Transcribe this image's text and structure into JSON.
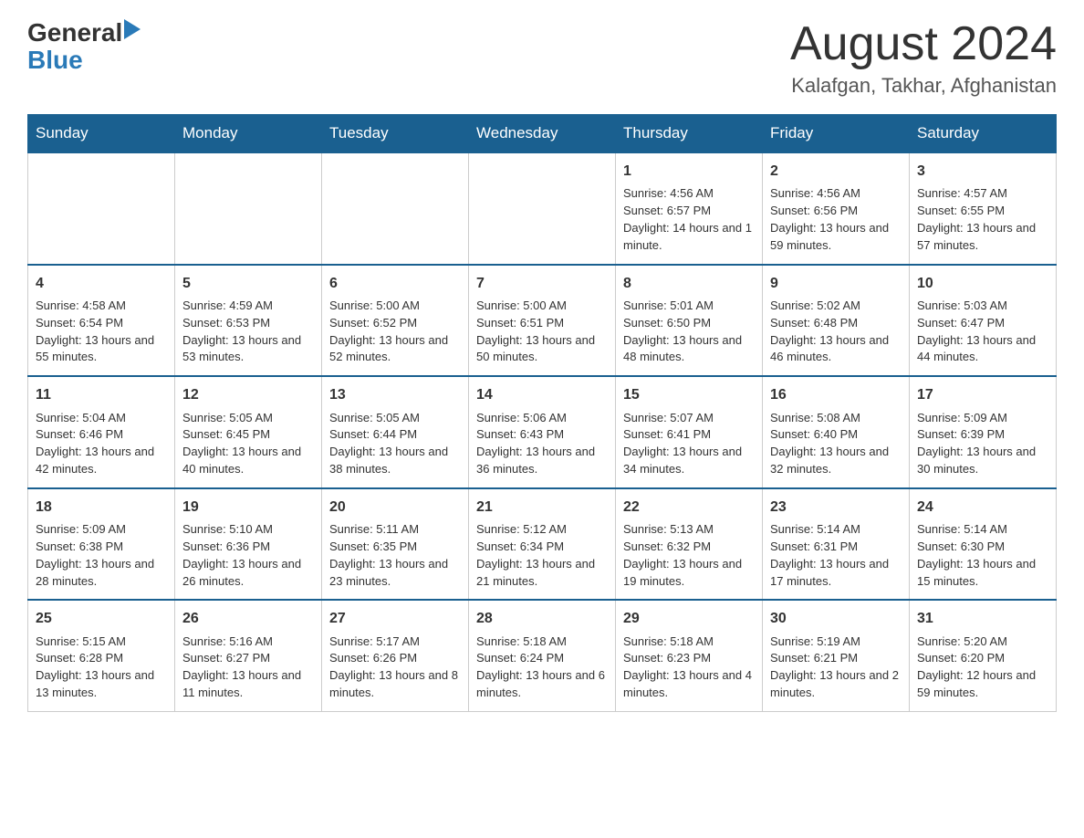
{
  "header": {
    "logo_general": "General",
    "logo_blue": "Blue",
    "month_title": "August 2024",
    "location": "Kalafgan, Takhar, Afghanistan"
  },
  "weekdays": [
    "Sunday",
    "Monday",
    "Tuesday",
    "Wednesday",
    "Thursday",
    "Friday",
    "Saturday"
  ],
  "weeks": [
    [
      {
        "day": "",
        "sunrise": "",
        "sunset": "",
        "daylight": ""
      },
      {
        "day": "",
        "sunrise": "",
        "sunset": "",
        "daylight": ""
      },
      {
        "day": "",
        "sunrise": "",
        "sunset": "",
        "daylight": ""
      },
      {
        "day": "",
        "sunrise": "",
        "sunset": "",
        "daylight": ""
      },
      {
        "day": "1",
        "sunrise": "Sunrise: 4:56 AM",
        "sunset": "Sunset: 6:57 PM",
        "daylight": "Daylight: 14 hours and 1 minute."
      },
      {
        "day": "2",
        "sunrise": "Sunrise: 4:56 AM",
        "sunset": "Sunset: 6:56 PM",
        "daylight": "Daylight: 13 hours and 59 minutes."
      },
      {
        "day": "3",
        "sunrise": "Sunrise: 4:57 AM",
        "sunset": "Sunset: 6:55 PM",
        "daylight": "Daylight: 13 hours and 57 minutes."
      }
    ],
    [
      {
        "day": "4",
        "sunrise": "Sunrise: 4:58 AM",
        "sunset": "Sunset: 6:54 PM",
        "daylight": "Daylight: 13 hours and 55 minutes."
      },
      {
        "day": "5",
        "sunrise": "Sunrise: 4:59 AM",
        "sunset": "Sunset: 6:53 PM",
        "daylight": "Daylight: 13 hours and 53 minutes."
      },
      {
        "day": "6",
        "sunrise": "Sunrise: 5:00 AM",
        "sunset": "Sunset: 6:52 PM",
        "daylight": "Daylight: 13 hours and 52 minutes."
      },
      {
        "day": "7",
        "sunrise": "Sunrise: 5:00 AM",
        "sunset": "Sunset: 6:51 PM",
        "daylight": "Daylight: 13 hours and 50 minutes."
      },
      {
        "day": "8",
        "sunrise": "Sunrise: 5:01 AM",
        "sunset": "Sunset: 6:50 PM",
        "daylight": "Daylight: 13 hours and 48 minutes."
      },
      {
        "day": "9",
        "sunrise": "Sunrise: 5:02 AM",
        "sunset": "Sunset: 6:48 PM",
        "daylight": "Daylight: 13 hours and 46 minutes."
      },
      {
        "day": "10",
        "sunrise": "Sunrise: 5:03 AM",
        "sunset": "Sunset: 6:47 PM",
        "daylight": "Daylight: 13 hours and 44 minutes."
      }
    ],
    [
      {
        "day": "11",
        "sunrise": "Sunrise: 5:04 AM",
        "sunset": "Sunset: 6:46 PM",
        "daylight": "Daylight: 13 hours and 42 minutes."
      },
      {
        "day": "12",
        "sunrise": "Sunrise: 5:05 AM",
        "sunset": "Sunset: 6:45 PM",
        "daylight": "Daylight: 13 hours and 40 minutes."
      },
      {
        "day": "13",
        "sunrise": "Sunrise: 5:05 AM",
        "sunset": "Sunset: 6:44 PM",
        "daylight": "Daylight: 13 hours and 38 minutes."
      },
      {
        "day": "14",
        "sunrise": "Sunrise: 5:06 AM",
        "sunset": "Sunset: 6:43 PM",
        "daylight": "Daylight: 13 hours and 36 minutes."
      },
      {
        "day": "15",
        "sunrise": "Sunrise: 5:07 AM",
        "sunset": "Sunset: 6:41 PM",
        "daylight": "Daylight: 13 hours and 34 minutes."
      },
      {
        "day": "16",
        "sunrise": "Sunrise: 5:08 AM",
        "sunset": "Sunset: 6:40 PM",
        "daylight": "Daylight: 13 hours and 32 minutes."
      },
      {
        "day": "17",
        "sunrise": "Sunrise: 5:09 AM",
        "sunset": "Sunset: 6:39 PM",
        "daylight": "Daylight: 13 hours and 30 minutes."
      }
    ],
    [
      {
        "day": "18",
        "sunrise": "Sunrise: 5:09 AM",
        "sunset": "Sunset: 6:38 PM",
        "daylight": "Daylight: 13 hours and 28 minutes."
      },
      {
        "day": "19",
        "sunrise": "Sunrise: 5:10 AM",
        "sunset": "Sunset: 6:36 PM",
        "daylight": "Daylight: 13 hours and 26 minutes."
      },
      {
        "day": "20",
        "sunrise": "Sunrise: 5:11 AM",
        "sunset": "Sunset: 6:35 PM",
        "daylight": "Daylight: 13 hours and 23 minutes."
      },
      {
        "day": "21",
        "sunrise": "Sunrise: 5:12 AM",
        "sunset": "Sunset: 6:34 PM",
        "daylight": "Daylight: 13 hours and 21 minutes."
      },
      {
        "day": "22",
        "sunrise": "Sunrise: 5:13 AM",
        "sunset": "Sunset: 6:32 PM",
        "daylight": "Daylight: 13 hours and 19 minutes."
      },
      {
        "day": "23",
        "sunrise": "Sunrise: 5:14 AM",
        "sunset": "Sunset: 6:31 PM",
        "daylight": "Daylight: 13 hours and 17 minutes."
      },
      {
        "day": "24",
        "sunrise": "Sunrise: 5:14 AM",
        "sunset": "Sunset: 6:30 PM",
        "daylight": "Daylight: 13 hours and 15 minutes."
      }
    ],
    [
      {
        "day": "25",
        "sunrise": "Sunrise: 5:15 AM",
        "sunset": "Sunset: 6:28 PM",
        "daylight": "Daylight: 13 hours and 13 minutes."
      },
      {
        "day": "26",
        "sunrise": "Sunrise: 5:16 AM",
        "sunset": "Sunset: 6:27 PM",
        "daylight": "Daylight: 13 hours and 11 minutes."
      },
      {
        "day": "27",
        "sunrise": "Sunrise: 5:17 AM",
        "sunset": "Sunset: 6:26 PM",
        "daylight": "Daylight: 13 hours and 8 minutes."
      },
      {
        "day": "28",
        "sunrise": "Sunrise: 5:18 AM",
        "sunset": "Sunset: 6:24 PM",
        "daylight": "Daylight: 13 hours and 6 minutes."
      },
      {
        "day": "29",
        "sunrise": "Sunrise: 5:18 AM",
        "sunset": "Sunset: 6:23 PM",
        "daylight": "Daylight: 13 hours and 4 minutes."
      },
      {
        "day": "30",
        "sunrise": "Sunrise: 5:19 AM",
        "sunset": "Sunset: 6:21 PM",
        "daylight": "Daylight: 13 hours and 2 minutes."
      },
      {
        "day": "31",
        "sunrise": "Sunrise: 5:20 AM",
        "sunset": "Sunset: 6:20 PM",
        "daylight": "Daylight: 12 hours and 59 minutes."
      }
    ]
  ]
}
